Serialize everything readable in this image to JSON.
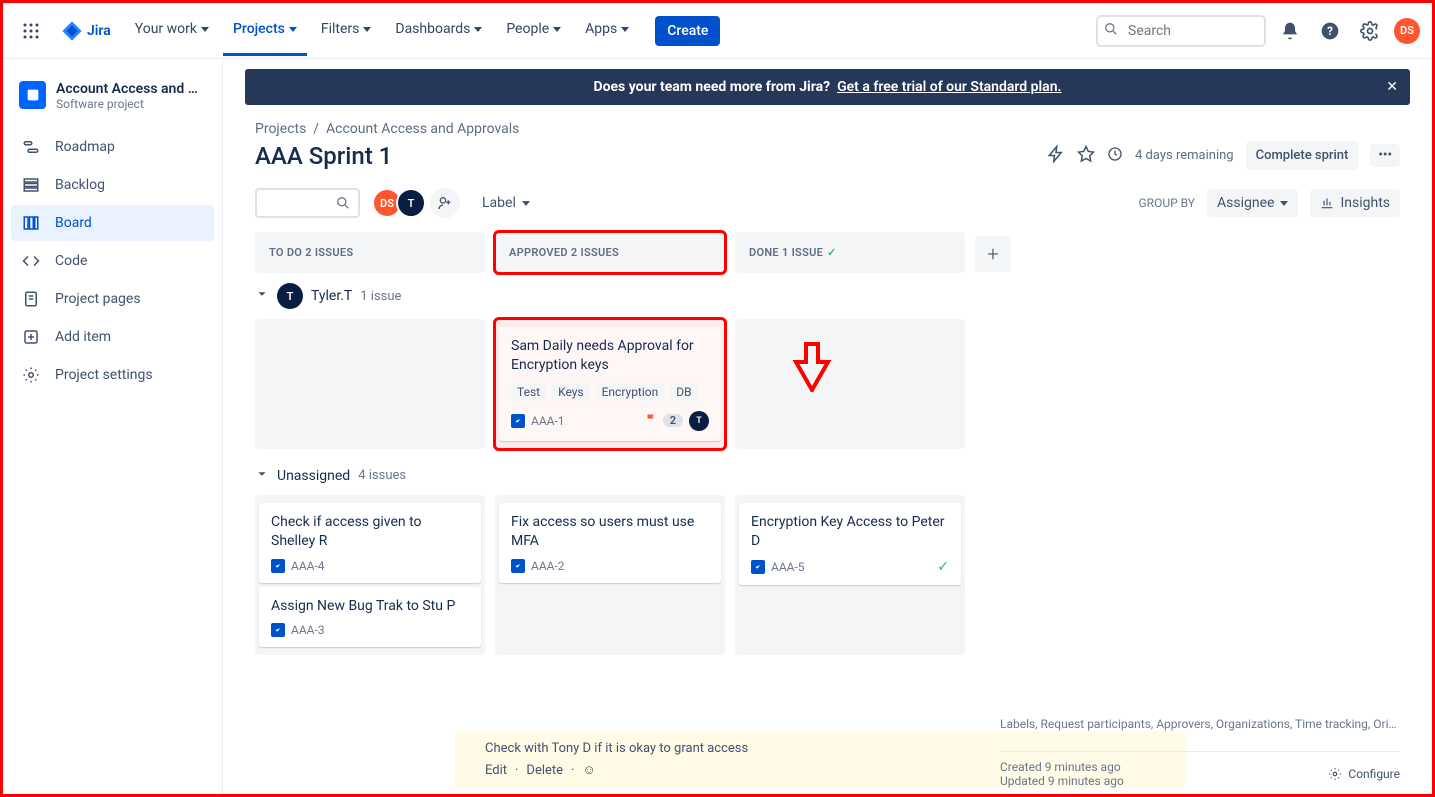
{
  "nav": {
    "product": "Jira",
    "items": {
      "your_work": "Your work",
      "projects": "Projects",
      "filters": "Filters",
      "dashboards": "Dashboards",
      "people": "People",
      "apps": "Apps"
    },
    "create": "Create",
    "search_placeholder": "Search",
    "user_initials": "DS"
  },
  "banner": {
    "lead": "Does your team need more from Jira?",
    "cta": "Get a free trial of our Standard plan."
  },
  "sidebar": {
    "project_name": "Account Access and Ap…",
    "project_sub": "Software project",
    "items": {
      "roadmap": "Roadmap",
      "backlog": "Backlog",
      "board": "Board",
      "code": "Code",
      "pages": "Project pages",
      "add": "Add item",
      "settings": "Project settings"
    }
  },
  "breadcrumb": {
    "a": "Projects",
    "b": "Account Access and Approvals"
  },
  "page": {
    "title": "AAA Sprint 1",
    "remaining": "4 days remaining",
    "complete": "Complete sprint"
  },
  "toolbar": {
    "label": "Label",
    "avatar1": "DS",
    "avatar2": "T",
    "group_by_label": "GROUP BY",
    "group_by_value": "Assignee",
    "insights": "Insights"
  },
  "columns": {
    "todo": "TO DO 2 ISSUES",
    "approved": "APPROVED 2 ISSUES",
    "done": "DONE 1 ISSUE"
  },
  "lanes": {
    "tyler": {
      "av": "T",
      "name": "Tyler.T",
      "count": "1 issue"
    },
    "unassigned": {
      "name": "Unassigned",
      "count": "4 issues"
    }
  },
  "cards": {
    "aaa1": {
      "title": "Sam Daily needs Approval for Encryption keys",
      "tags": {
        "t1": "Test",
        "t2": "Keys",
        "t3": "Encryption",
        "t4": "DB"
      },
      "key": "AAA-1",
      "estimate": "2",
      "assignee": "T"
    },
    "aaa4": {
      "title": "Check if access given to Shelley R",
      "key": "AAA-4"
    },
    "aaa3": {
      "title": "Assign New Bug Trak to Stu P",
      "key": "AAA-3"
    },
    "aaa2": {
      "title": "Fix access so users must use MFA",
      "key": "AAA-2"
    },
    "aaa5": {
      "title": "Encryption Key Access to Peter D",
      "key": "AAA-5"
    }
  },
  "activity": {
    "text": "Check with Tony D if it is okay to grant access",
    "edit": "Edit",
    "delete": "Delete"
  },
  "meta": {
    "line": "Labels, Request participants, Approvers, Organizations, Time tracking, Original est…",
    "created": "Created 9 minutes ago",
    "updated": "Updated 9 minutes ago",
    "configure": "Configure"
  }
}
